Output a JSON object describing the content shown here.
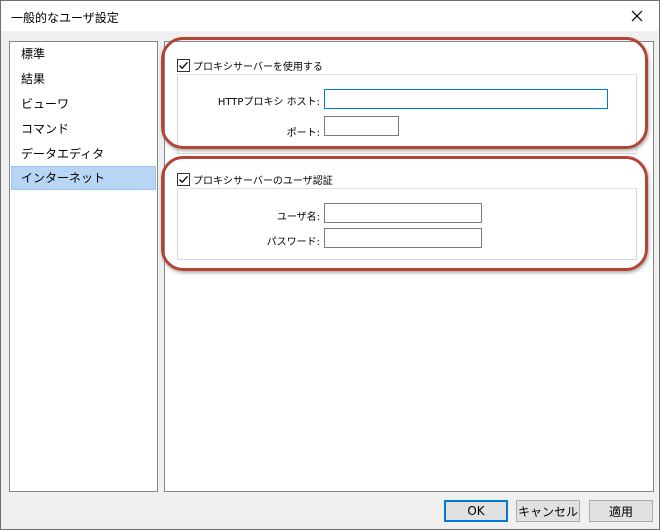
{
  "window": {
    "title": "一般的なユーザ設定"
  },
  "sidebar": {
    "items": [
      {
        "label": "標準"
      },
      {
        "label": "結果"
      },
      {
        "label": "ビューワ"
      },
      {
        "label": "コマンド"
      },
      {
        "label": "データエディタ"
      },
      {
        "label": "インターネット",
        "selected": true
      }
    ]
  },
  "proxy": {
    "checkbox_label": "プロキシサーバーを使用する",
    "checked": true,
    "host_label": "HTTPプロキシ ホスト:",
    "host_value": "",
    "port_label": "ポート:",
    "port_value": ""
  },
  "auth": {
    "checkbox_label": "プロキシサーバーのユーザ認証",
    "checked": true,
    "username_label": "ユーザ名:",
    "username_value": "",
    "password_label": "パスワード:",
    "password_value": ""
  },
  "buttons": {
    "ok": "OK",
    "cancel": "キャンセル",
    "apply": "適用"
  },
  "colors": {
    "highlight": "#b24636",
    "selection": "#b8d6f4",
    "focus": "#0078d7"
  }
}
